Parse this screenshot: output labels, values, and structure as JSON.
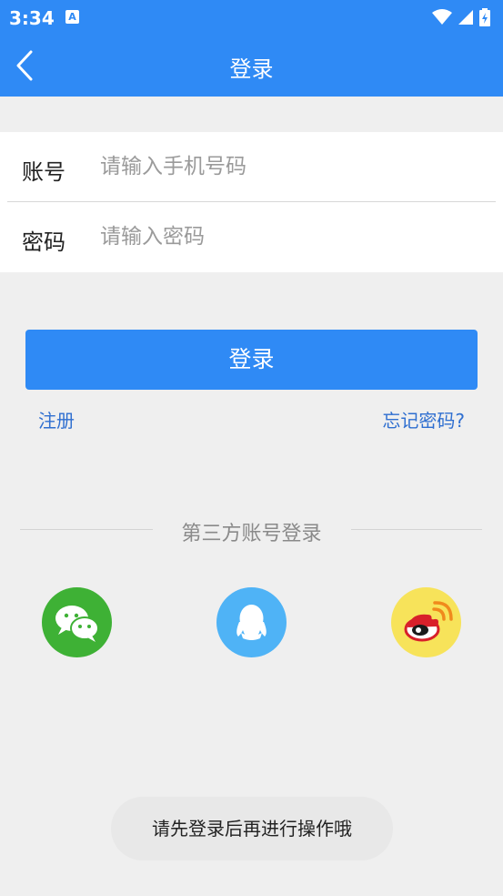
{
  "status_bar": {
    "time": "3:34",
    "notification_glyph": "A"
  },
  "toolbar": {
    "title": "登录"
  },
  "form": {
    "account": {
      "label": "账号",
      "placeholder": "请输入手机号码",
      "value": ""
    },
    "password": {
      "label": "密码",
      "placeholder": "请输入密码",
      "value": ""
    }
  },
  "actions": {
    "login_label": "登录",
    "register_label": "注册",
    "forgot_label": "忘记密码?"
  },
  "third_party": {
    "heading": "第三方账号登录",
    "providers": [
      {
        "icon": "wechat-icon",
        "color": "#3eb135"
      },
      {
        "icon": "qq-icon",
        "color": "#4fb3f6"
      },
      {
        "icon": "weibo-icon",
        "color": "#f7e35a"
      }
    ]
  },
  "toast": {
    "message": "请先登录后再进行操作哦"
  },
  "colors": {
    "primary": "#2f8af5",
    "link": "#2f6fd0",
    "background": "#efefef"
  }
}
